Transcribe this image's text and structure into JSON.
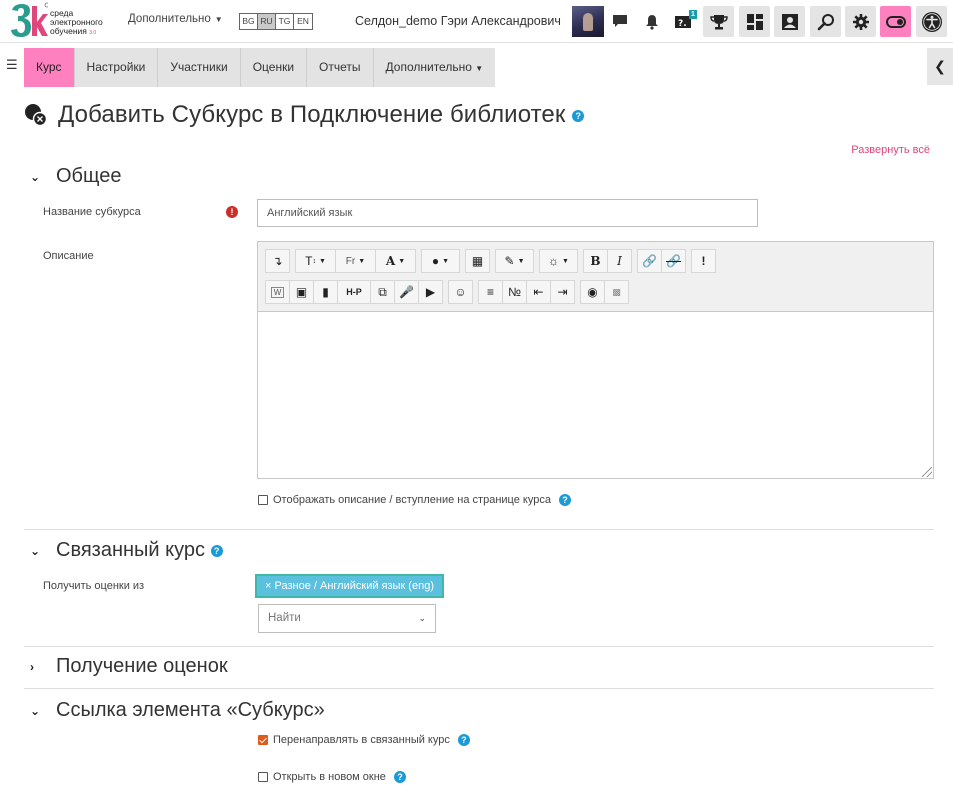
{
  "header": {
    "logo": {
      "line1": "среда",
      "line2": "электронного",
      "line3": "обучения",
      "line3_suffix": "3.0"
    },
    "more_label": "Дополнительно",
    "languages": [
      {
        "code": "BG",
        "active": false
      },
      {
        "code": "RU",
        "active": true
      },
      {
        "code": "TG",
        "active": false
      },
      {
        "code": "EN",
        "active": false
      }
    ],
    "user_name": "Селдон_demo Гэри Александрович",
    "notification_badge": "1",
    "accent_color": "#ff80bf"
  },
  "subnav": {
    "tabs": [
      {
        "label": "Курс",
        "active": true
      },
      {
        "label": "Настройки",
        "active": false
      },
      {
        "label": "Участники",
        "active": false
      },
      {
        "label": "Оценки",
        "active": false
      },
      {
        "label": "Отчеты",
        "active": false
      },
      {
        "label": "Дополнительно",
        "active": false
      }
    ]
  },
  "page": {
    "title": "Добавить Субкурс в Подключение библиотек",
    "expand_all": "Развернуть всё"
  },
  "sections": {
    "general": {
      "title": "Общее",
      "name_label": "Название субкурса",
      "name_value": "Английский язык",
      "description_label": "Описание",
      "show_description_label": "Отображать описание / вступление на странице курса",
      "show_description_checked": false
    },
    "linked": {
      "title": "Связанный курс",
      "grades_from_label": "Получить оценки из",
      "selected_tag": "Разное / Английский язык (eng)",
      "search_placeholder": "Найти"
    },
    "grades": {
      "title": "Получение оценок"
    },
    "link": {
      "title": "Ссылка элемента «Субкурс»",
      "redirect_label": "Перенаправлять в связанный курс",
      "redirect_checked": true,
      "new_window_label": "Открыть в новом окне",
      "new_window_checked": false
    }
  },
  "editor": {
    "toolbar_row1": [
      "paragraph-icon",
      "font-size-icon",
      "font-family-icon",
      "font-color-icon",
      "background-color-icon",
      "cube-icon",
      "styles-icon",
      "bulb-icon",
      "bold-icon",
      "italic-icon",
      "link-icon",
      "unlink-icon",
      "exclamation-icon"
    ],
    "toolbar_row2": [
      "word-import-icon",
      "image-icon",
      "media-icon",
      "h5p-icon",
      "copy-icon",
      "microphone-icon",
      "video-icon",
      "emoji-icon",
      "unordered-list-icon",
      "ordered-list-icon",
      "outdent-icon",
      "indent-icon",
      "accessibility-icon",
      "screenreader-icon"
    ]
  }
}
